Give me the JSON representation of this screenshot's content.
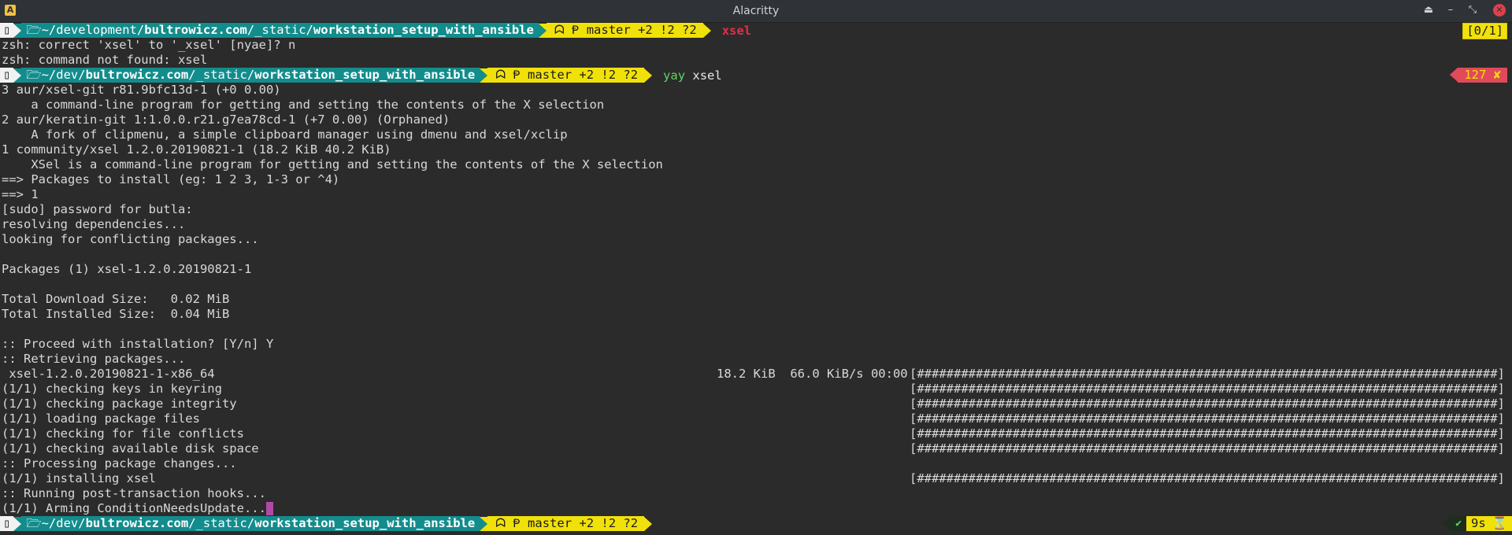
{
  "window": {
    "title": "Alacritty",
    "app_icon": "A",
    "controls": [
      "⏏",
      "–",
      "⤡",
      "✕"
    ]
  },
  "prompt": {
    "os_icon": "▯",
    "folder_icon": "🗁",
    "path1": {
      "pre": "~/development/",
      "bold1": "bultrowicz.com",
      "mid": "/_static/",
      "bold2": "workstation_setup_with_ansible"
    },
    "path2": {
      "pre": "~/dev/",
      "bold1": "bultrowicz.com",
      "mid": "/_static/",
      "bold2": "workstation_setup_with_ansible"
    },
    "git_icons": "ᗣ Ᵽ",
    "git_status": "master +2 !2 ?2"
  },
  "commands": {
    "first": "xsel",
    "second_cmd": "yay",
    "second_arg": " xsel"
  },
  "right": {
    "count": "[0/1]",
    "error": "127 ✘",
    "ok": "✔",
    "time": "9s",
    "hourglass": "⌛"
  },
  "lines": [
    "zsh: correct 'xsel' to '_xsel' [nyae]? n",
    "zsh: command not found: xsel",
    "3 aur/xsel-git r81.9bfc13d-1 (+0 0.00)",
    "    a command-line program for getting and setting the contents of the X selection",
    "2 aur/keratin-git 1:1.0.0.r21.g7ea78cd-1 (+7 0.00) (Orphaned)",
    "    A fork of clipmenu, a simple clipboard manager using dmenu and xsel/xclip",
    "1 community/xsel 1.2.0.20190821-1 (18.2 KiB 40.2 KiB)",
    "    XSel is a command-line program for getting and setting the contents of the X selection",
    "==> Packages to install (eg: 1 2 3, 1-3 or ^4)",
    "==> 1",
    "[sudo] password for butla:",
    "resolving dependencies...",
    "looking for conflicting packages...",
    "",
    "Packages (1) xsel-1.2.0.20190821-1",
    "",
    "Total Download Size:   0.02 MiB",
    "Total Installed Size:  0.04 MiB",
    "",
    ":: Proceed with installation? [Y/n] Y",
    ":: Retrieving packages...",
    " xsel-1.2.0.20190821-1-x86_64",
    "(1/1) checking keys in keyring",
    "(1/1) checking package integrity",
    "(1/1) loading package files",
    "(1/1) checking for file conflicts",
    "(1/1) checking available disk space",
    ":: Processing package changes...",
    "(1/1) installing xsel",
    ":: Running post-transaction hooks...",
    "(1/1) Arming ConditionNeedsUpdate..."
  ],
  "download_stats": "18.2 KiB  66.0 KiB/s 00:00",
  "progress_bar": "[###############################################################################] 100%"
}
